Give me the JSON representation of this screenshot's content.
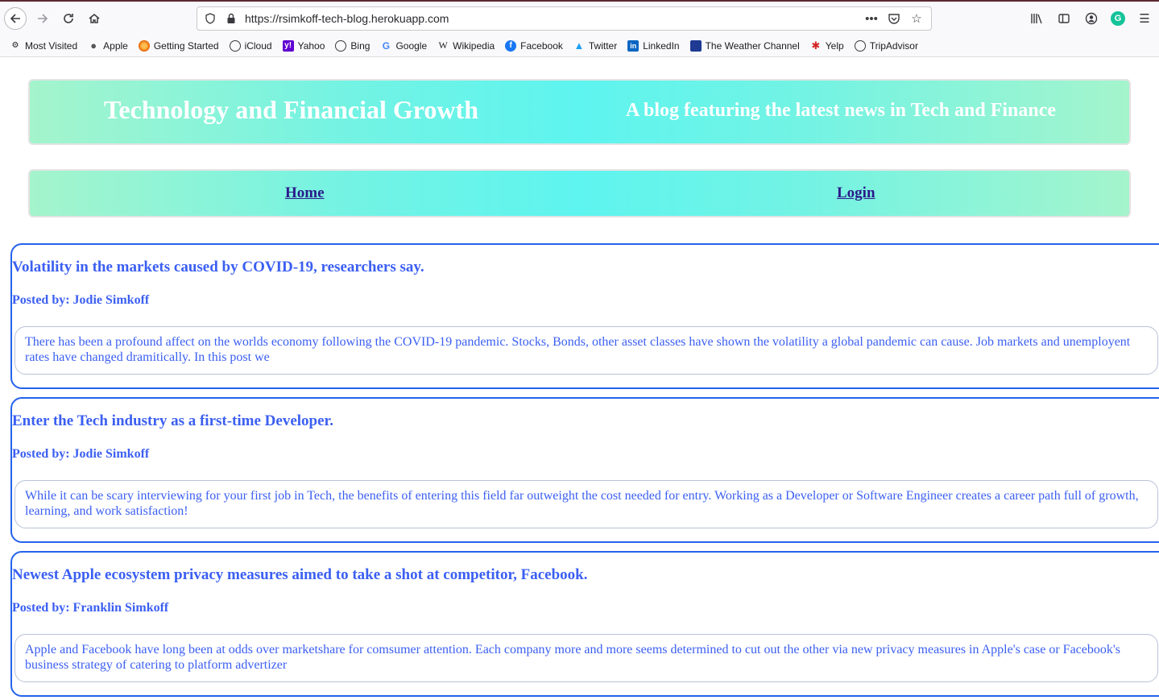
{
  "browser": {
    "url": "https://rsimkoff-tech-blog.herokuapp.com",
    "bookmarks": [
      {
        "label": "Most Visited",
        "icon": "gear-icon"
      },
      {
        "label": "Apple",
        "icon": "apple-icon"
      },
      {
        "label": "Getting Started",
        "icon": "firefox-icon"
      },
      {
        "label": "iCloud",
        "icon": "globe-icon"
      },
      {
        "label": "Yahoo",
        "icon": "yahoo-icon"
      },
      {
        "label": "Bing",
        "icon": "globe-icon"
      },
      {
        "label": "Google",
        "icon": "google-icon"
      },
      {
        "label": "Wikipedia",
        "icon": "wikipedia-icon"
      },
      {
        "label": "Facebook",
        "icon": "facebook-icon"
      },
      {
        "label": "Twitter",
        "icon": "twitter-icon"
      },
      {
        "label": "LinkedIn",
        "icon": "linkedin-icon"
      },
      {
        "label": "The Weather Channel",
        "icon": "weather-channel-icon"
      },
      {
        "label": "Yelp",
        "icon": "yelp-icon"
      },
      {
        "label": "TripAdvisor",
        "icon": "globe-icon"
      }
    ]
  },
  "header": {
    "title": "Technology and Financial Growth",
    "tagline": "A blog featuring the latest news in Tech and Finance"
  },
  "nav": {
    "home": "Home",
    "login": "Login"
  },
  "posts": [
    {
      "title": "Volatility in the markets caused by COVID-19, researchers say.",
      "author": "Posted by: Jodie Simkoff",
      "body": "There has been a profound affect on the worlds economy following the COVID-19 pandemic. Stocks, Bonds, other asset classes have shown the volatility a global pandemic can cause. Job markets and unemplo­yent rates have changed dramitically. In this post we"
    },
    {
      "title": "Enter the Tech industry as a first-time Developer.",
      "author": "Posted by: Jodie Simkoff",
      "body": "While it can be scary interviewing for your first job in Tech, the benefits of entering this field far outweight the cost needed for entry. Working as a Developer or Software Engineer creates a career path full of growth, learning, and work satisfaction!"
    },
    {
      "title": "Newest Apple ecosystem privacy measures aimed to take a shot at competitor, Facebook.",
      "author": "Posted by: Franklin Simkoff",
      "body": "Apple and Facebook have long been at odds over marketshare for comsumer attention. Each company more and more seems determined to cut out the other via new privacy measures in Apple's case or Facebook's business strategy of catering to platform advertizer"
    }
  ]
}
